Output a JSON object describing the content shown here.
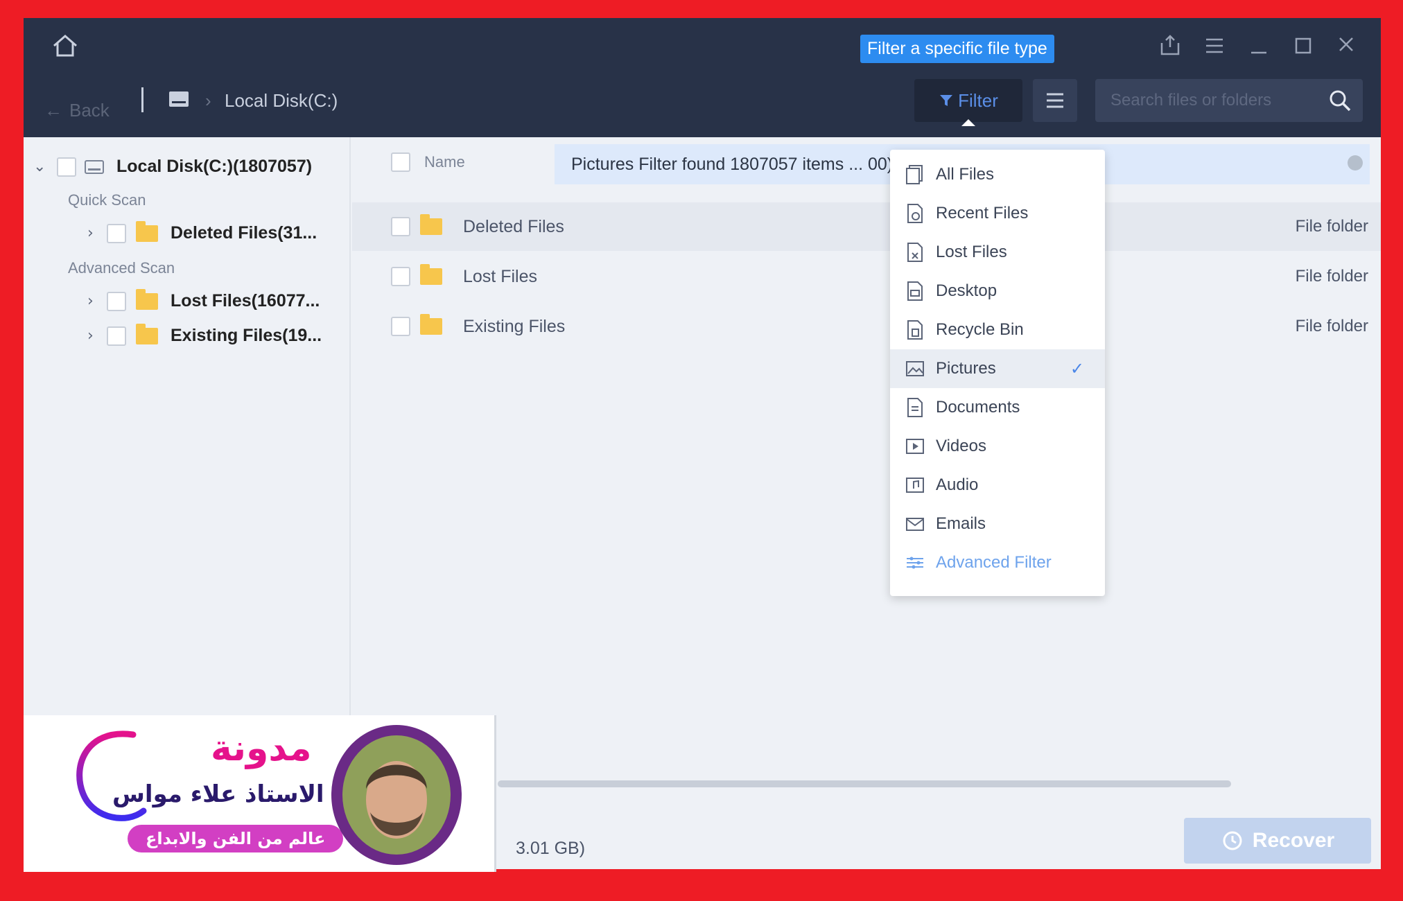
{
  "tooltip": "Filter a specific file type",
  "toolbar": {
    "back_label": "Back",
    "breadcrumb": "Local Disk(C:)",
    "filter_label": "Filter",
    "search_placeholder": "Search files or folders"
  },
  "tree": {
    "root_label": "Local Disk(C:)(1807057)",
    "quick_scan_label": "Quick Scan",
    "advanced_scan_label": "Advanced Scan",
    "deleted_label": "Deleted Files(31...",
    "lost_label": "Lost Files(16077...",
    "existing_label": "Existing Files(19..."
  },
  "list": {
    "name_header": "Name",
    "banner": "Pictures Filter found 1807057 items ... 00)",
    "rows": [
      {
        "name": "Deleted Files",
        "type": "File folder"
      },
      {
        "name": "Lost Files",
        "type": "File folder"
      },
      {
        "name": "Existing Files",
        "type": "File folder"
      }
    ]
  },
  "dropdown": {
    "items": [
      {
        "label": "All Files"
      },
      {
        "label": "Recent Files"
      },
      {
        "label": "Lost Files"
      },
      {
        "label": "Desktop"
      },
      {
        "label": "Recycle Bin"
      },
      {
        "label": "Pictures",
        "check": "✓"
      },
      {
        "label": "Documents"
      },
      {
        "label": "Videos"
      },
      {
        "label": "Audio"
      },
      {
        "label": "Emails"
      },
      {
        "label": "Advanced Filter"
      }
    ]
  },
  "footer": {
    "size_text": "3.01 GB)",
    "recover_label": "Recover"
  },
  "promo": {
    "title": "مدونة",
    "name": "الاستاذ علاء مواس",
    "tagline": "عالم من الفن والابداع"
  },
  "colors": {
    "frame": "#ee1c25",
    "titlebar": "#283248",
    "accent": "#2d8cf0",
    "folder": "#f7c64c",
    "promo_pink": "#e5128b"
  }
}
